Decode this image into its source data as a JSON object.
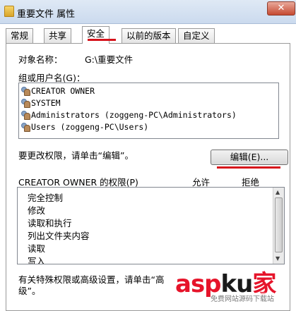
{
  "window": {
    "title": "重要文件 属性",
    "close_glyph": "✕"
  },
  "tabs": [
    {
      "label": "常规"
    },
    {
      "label": "共享"
    },
    {
      "label": "安全"
    },
    {
      "label": "以前的版本"
    },
    {
      "label": "自定义"
    }
  ],
  "security": {
    "object_label": "对象名称：",
    "object_value": "G:\\重要文件",
    "group_label": "组或用户名(G)：",
    "principals": [
      {
        "text": "CREATOR OWNER"
      },
      {
        "text": "SYSTEM"
      },
      {
        "text": "Administrators (zoggeng-PC\\Administrators)"
      },
      {
        "text": "Users (zoggeng-PC\\Users)"
      }
    ],
    "change_hint": "要更改权限，请单击“编辑”。",
    "edit_button": "编辑(E)...",
    "perm_header": "CREATOR OWNER 的权限(P)",
    "allow_header": "允许",
    "deny_header": "拒绝",
    "permissions": [
      {
        "name": "完全控制"
      },
      {
        "name": "修改"
      },
      {
        "name": "读取和执行"
      },
      {
        "name": "列出文件夹内容"
      },
      {
        "name": "读取"
      },
      {
        "name": "写入"
      }
    ],
    "special_hint_1": "有关特殊权限或高级设置，请单击“高",
    "special_hint_2": "级”。"
  },
  "watermark": {
    "main_left": "asp",
    "main_k": "ku",
    "main_right": "家",
    "sub": "免费网站源码下载站"
  },
  "colors": {
    "accent_red": "#d6131b",
    "titlebar": "#cbdaee"
  }
}
